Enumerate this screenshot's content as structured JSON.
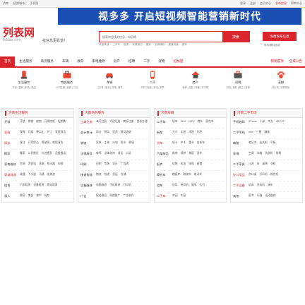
{
  "topbar": {
    "left": [
      "济南",
      "[切换城市]",
      "手机版"
    ],
    "right": [
      "登录",
      "注册",
      "会员中心",
      "发布信息",
      "帮助中心"
    ]
  },
  "banner": {
    "text": "视多多 开启短视频智能营销新时代"
  },
  "header": {
    "logo": "列表网",
    "logo_sub": "liebiao.com",
    "slogan": "找信息更靠谱！",
    "search_placeholder": "搜索你想找的信息，如招聘",
    "search_button": "搜索",
    "hot_words": [
      "开锁换锁",
      "二手车",
      "租房",
      "家政保洁",
      "搬家",
      "空调维修",
      "管道疏通",
      "宽带"
    ],
    "post_button": "免费发布信息",
    "post_sub": "修改/删除信息"
  },
  "nav": {
    "items": [
      "首页",
      "生活服务",
      "商务服务",
      "车辆",
      "教育",
      "家电维修",
      "房产",
      "招聘",
      "二手",
      "宠物",
      "招加盟"
    ],
    "active_index": 0,
    "hot_index": 10,
    "right": [
      "我要置顶",
      "全城公告"
    ]
  },
  "categories": [
    {
      "title": "生活服务",
      "sub": "开锁 | 搬家 | 家政 | 保洁",
      "icon": "cleaning-icon"
    },
    {
      "title": "商务服务",
      "sub": "公司注册 | 装修 | 广告",
      "icon": "briefcase-icon"
    },
    {
      "title": "车辆",
      "sub": "二手车 | 租车 | 货车 | 摩托",
      "icon": "car-icon"
    },
    {
      "title": "二手",
      "sub": "手机 | 电脑 | 家电 | 家具",
      "icon": "phone-icon"
    },
    {
      "title": "房产",
      "sub": "租房 | 出售 | 商铺 | 写字楼",
      "icon": "house-icon"
    },
    {
      "title": "招聘",
      "sub": "司机 | 销售 | 普工 | 客服",
      "icon": "briefcase-icon"
    },
    {
      "title": "宠物",
      "sub": "猫 | 狗 | 宠物用品",
      "icon": "paw-icon"
    }
  ],
  "panels": [
    {
      "title": "济南生活服务",
      "rows": [
        {
          "label": "开锁",
          "items": [
            "开锁",
            "换锁",
            "修锁",
            "开保险柜",
            "配钥匙"
          ]
        },
        {
          "label": "家政",
          "items": [
            "保姆",
            "月嫂",
            "钟点工",
            "护工",
            "家庭保洁"
          ],
          "red": true
        },
        {
          "label": "保洁",
          "items": [
            "保洁",
            "开荒保洁",
            "擦玻璃",
            "地毯清洗"
          ],
          "red": true
        },
        {
          "label": "搬家",
          "items": [
            "搬家",
            "公司搬迁",
            "长途搬家",
            "设备搬运"
          ]
        },
        {
          "label": "家电维修",
          "items": [
            "空调",
            "洗衣机",
            "冰箱",
            "热水器",
            "电视"
          ]
        },
        {
          "label": "管道疏通",
          "items": [
            "疏通",
            "下水道",
            "马桶",
            "化粪池"
          ],
          "red": true
        },
        {
          "label": "租赁",
          "items": [
            "汽车租赁",
            "设备租赁",
            "家电租赁"
          ]
        },
        {
          "label": "丽人",
          "items": [
            "美容",
            "美发",
            "美甲",
            "化妆"
          ]
        }
      ]
    },
    {
      "title": "济南商务服务",
      "rows": [
        {
          "label": "工商注册",
          "items": [
            "公司注册",
            "代理记账",
            "商标注册",
            "资质办理"
          ],
          "red": true
        },
        {
          "label": "会计审计",
          "items": [
            "审计",
            "税务",
            "验资",
            "财务咨询"
          ]
        },
        {
          "label": "装修",
          "items": [
            "家装",
            "工装",
            "水电",
            "防水",
            "刷墙"
          ]
        },
        {
          "label": "法律服务",
          "items": [
            "律师",
            "法律咨询",
            "诉讼",
            "公证"
          ]
        },
        {
          "label": "印刷",
          "items": [
            "印刷",
            "包装",
            "设计",
            "广告牌"
          ]
        },
        {
          "label": "快递物流",
          "items": [
            "物流",
            "快递",
            "货运",
            "仓储"
          ]
        },
        {
          "label": "设备维修",
          "items": [
            "电脑维修",
            "手机维修",
            "打印机"
          ]
        },
        {
          "label": "广告",
          "items": [
            "网站建设",
            "网络推广",
            "广告制作"
          ]
        }
      ]
    },
    {
      "title": "济南车辆",
      "rows": [
        {
          "label": "二手车",
          "items": [
            "轿车",
            "SUV",
            "MPV",
            "跑车",
            "面包车"
          ]
        },
        {
          "label": "新车",
          "items": [
            "大众",
            "丰田",
            "本田",
            "别克"
          ]
        },
        {
          "label": "货车",
          "items": [
            "轻卡",
            "中卡",
            "重卡",
            "自卸车"
          ],
          "red": true
        },
        {
          "label": "汽车服务",
          "items": [
            "维修",
            "保养",
            "美容",
            "洗车"
          ]
        },
        {
          "label": "配件",
          "items": [
            "轮胎",
            "机油",
            "电瓶",
            "座套"
          ]
        },
        {
          "label": "摩托车",
          "items": [
            "踏板车",
            "跨骑车",
            "电动车"
          ]
        },
        {
          "label": "租车",
          "items": [
            "自驾",
            "带司机",
            "婚车",
            "大巴"
          ]
        },
        {
          "label": "二手车",
          "items": [
            "本田",
            "丰田"
          ],
          "red": true
        }
      ]
    },
    {
      "title": "济南二手市场",
      "rows": [
        {
          "label": "手机数码",
          "items": [
            "iPhone",
            "小米",
            "华为",
            "OPPO"
          ]
        },
        {
          "label": "二手手机",
          "items": [
            "vivo",
            "三星",
            "魅族"
          ]
        },
        {
          "label": "电脑",
          "items": [
            "笔记本",
            "台式机",
            "平板"
          ]
        },
        {
          "label": "家电",
          "items": [
            "空调",
            "冰箱",
            "洗衣机",
            "电视"
          ]
        },
        {
          "label": "二手家具",
          "items": [
            "沙发",
            "床",
            "桌椅",
            "衣柜"
          ]
        },
        {
          "label": "办公用品",
          "items": [
            "办公桌",
            "打印机",
            "保险柜"
          ],
          "red": true
        },
        {
          "label": "二手设备",
          "items": [
            "机床",
            "发电机",
            "叉车"
          ],
          "red": true
        },
        {
          "label": "其他",
          "items": [
            "图书",
            "乐器",
            "运动器材"
          ]
        }
      ]
    }
  ]
}
